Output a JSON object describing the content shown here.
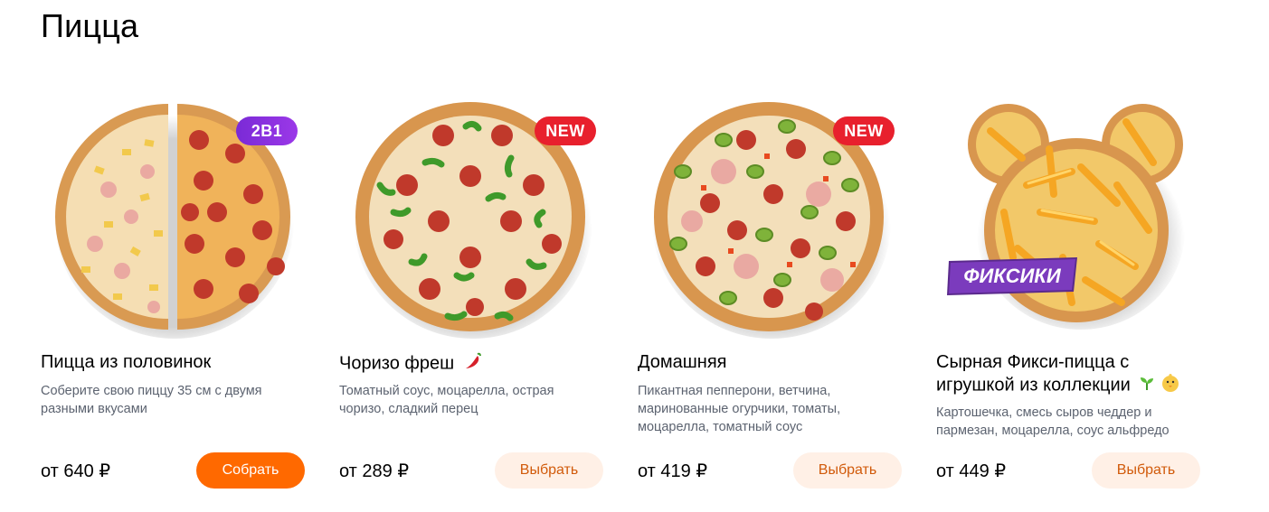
{
  "section": {
    "title": "Пицца"
  },
  "products": [
    {
      "name": "Пицца из половинок",
      "description": "Соберите свою пиццу 35 см с двумя разными вкусами",
      "price": "от 640 ₽",
      "button": "Собрать",
      "badge": "2В1",
      "image": "half-and-half-pizza"
    },
    {
      "name": "Чоризо фреш",
      "description": "Томатный соус, моцарелла, острая чоризо, сладкий перец",
      "price": "от 289 ₽",
      "button": "Выбрать",
      "badge": "NEW",
      "name_icon": "chili-pepper-icon",
      "image": "chorizo-pizza"
    },
    {
      "name": "Домашняя",
      "description": "Пикантная пепперони, ветчина, маринованные огурчики, томаты, моцарелла, томатный соус",
      "price": "от 419 ₽",
      "button": "Выбрать",
      "badge": "NEW",
      "image": "homemade-pizza"
    },
    {
      "name": "Сырная Фикси-пицца с игрушкой из коллекции",
      "description": "Картошечка, смесь сыров чеддер и пармезан, моцарелла, соус альфредо",
      "price": "от 449 ₽",
      "button": "Выбрать",
      "logo_text": "ФИКСИКИ",
      "name_icons": [
        "sprout-icon",
        "baby-chick-icon"
      ],
      "image": "mouse-shaped-pizza"
    }
  ],
  "colors": {
    "primary_button": "#ff6900",
    "secondary_button_bg": "#fff0e6",
    "secondary_button_text": "#d15a0a",
    "badge_purple": "#8a30de",
    "badge_red": "#e8202d"
  }
}
